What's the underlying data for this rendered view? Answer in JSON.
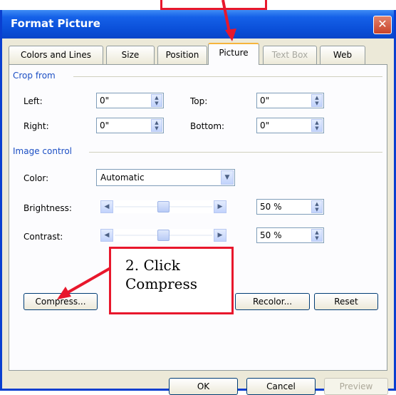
{
  "window": {
    "title": "Format Picture",
    "close_icon": "✕"
  },
  "tabs": [
    {
      "label": "Colors and Lines",
      "state": "normal"
    },
    {
      "label": "Size",
      "state": "normal"
    },
    {
      "label": "Position",
      "state": "normal"
    },
    {
      "label": "Picture",
      "state": "active"
    },
    {
      "label": "Text Box",
      "state": "disabled"
    },
    {
      "label": "Web",
      "state": "normal"
    }
  ],
  "crop": {
    "heading": "Crop from",
    "left_label": "Left:",
    "left_value": "0\"",
    "top_label": "Top:",
    "top_value": "0\"",
    "right_label": "Right:",
    "right_value": "0\"",
    "bottom_label": "Bottom:",
    "bottom_value": "0\""
  },
  "image_control": {
    "heading": "Image control",
    "color_label": "Color:",
    "color_value": "Automatic",
    "brightness_label": "Brightness:",
    "brightness_value": "50 %",
    "brightness_level": 0.5,
    "contrast_label": "Contrast:",
    "contrast_value": "50 %",
    "contrast_level": 0.5
  },
  "buttons": {
    "compress": "Compress...",
    "recolor": "Recolor...",
    "reset": "Reset",
    "ok": "OK",
    "cancel": "Cancel",
    "preview": "Preview"
  },
  "annotation": {
    "line1": "2. Click",
    "line2": "Compress",
    "color": "#e8172c"
  },
  "colors": {
    "title_bar": "#0a4fd8",
    "dialog_bg": "#ece9d8",
    "section_heading": "#1c4fc4",
    "active_tab_accent": "#f6b43c"
  }
}
